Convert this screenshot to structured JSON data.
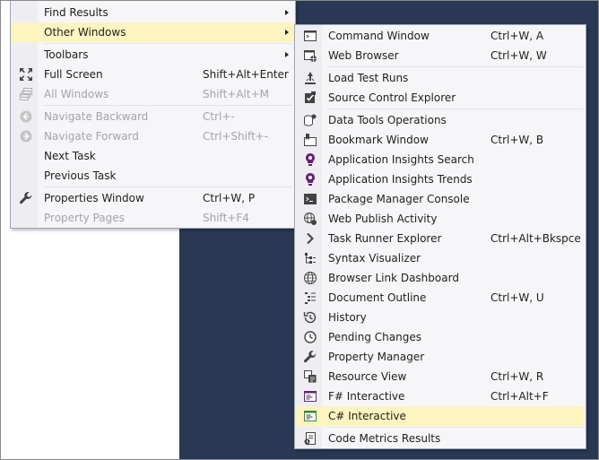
{
  "left_menu": {
    "items": [
      {
        "label": "Find Results",
        "shortcut": "",
        "icon": "none",
        "submenu": true,
        "disabled": false,
        "highlighted": false
      },
      {
        "label": "Other Windows",
        "shortcut": "",
        "icon": "none",
        "submenu": true,
        "disabled": false,
        "highlighted": true
      },
      {
        "label": "Toolbars",
        "shortcut": "",
        "icon": "none",
        "submenu": true,
        "disabled": false,
        "highlighted": false
      },
      {
        "label": "Full Screen",
        "shortcut": "Shift+Alt+Enter",
        "icon": "full-screen-icon",
        "submenu": false,
        "disabled": false,
        "highlighted": false
      },
      {
        "label": "All Windows",
        "shortcut": "Shift+Alt+M",
        "icon": "all-windows-icon",
        "submenu": false,
        "disabled": true,
        "highlighted": false
      },
      {
        "label": "Navigate Backward",
        "shortcut": "Ctrl+-",
        "icon": "navigate-backward-icon",
        "submenu": false,
        "disabled": true,
        "highlighted": false
      },
      {
        "label": "Navigate Forward",
        "shortcut": "Ctrl+Shift+-",
        "icon": "navigate-forward-icon",
        "submenu": false,
        "disabled": true,
        "highlighted": false
      },
      {
        "label": "Next Task",
        "shortcut": "",
        "icon": "none",
        "submenu": false,
        "disabled": false,
        "highlighted": false
      },
      {
        "label": "Previous Task",
        "shortcut": "",
        "icon": "none",
        "submenu": false,
        "disabled": false,
        "highlighted": false
      },
      {
        "label": "Properties Window",
        "shortcut": "Ctrl+W, P",
        "icon": "wrench-icon",
        "submenu": false,
        "disabled": false,
        "highlighted": false
      },
      {
        "label": "Property Pages",
        "shortcut": "Shift+F4",
        "icon": "none",
        "submenu": false,
        "disabled": true,
        "highlighted": false
      }
    ]
  },
  "right_menu": {
    "items": [
      {
        "label": "Command Window",
        "shortcut": "Ctrl+W, A",
        "icon": "command-window-icon",
        "highlighted": false
      },
      {
        "label": "Web Browser",
        "shortcut": "Ctrl+W, W",
        "icon": "web-browser-icon",
        "highlighted": false
      },
      {
        "label": "Load Test Runs",
        "shortcut": "",
        "icon": "load-test-runs-icon",
        "highlighted": false
      },
      {
        "label": "Source Control Explorer",
        "shortcut": "",
        "icon": "source-control-icon",
        "highlighted": false
      },
      {
        "label": "Data Tools Operations",
        "shortcut": "",
        "icon": "data-tools-icon",
        "highlighted": false
      },
      {
        "label": "Bookmark Window",
        "shortcut": "Ctrl+W, B",
        "icon": "bookmark-icon",
        "highlighted": false
      },
      {
        "label": "Application Insights Search",
        "shortcut": "",
        "icon": "lightbulb-icon",
        "highlighted": false
      },
      {
        "label": "Application Insights Trends",
        "shortcut": "",
        "icon": "lightbulb-icon",
        "highlighted": false
      },
      {
        "label": "Package Manager Console",
        "shortcut": "",
        "icon": "console-icon",
        "highlighted": false
      },
      {
        "label": "Web Publish Activity",
        "shortcut": "",
        "icon": "globe-gear-icon",
        "highlighted": false
      },
      {
        "label": "Task Runner Explorer",
        "shortcut": "Ctrl+Alt+Bkspce",
        "icon": "chevron-right-icon",
        "highlighted": false
      },
      {
        "label": "Syntax Visualizer",
        "shortcut": "",
        "icon": "tree-icon",
        "highlighted": false
      },
      {
        "label": "Browser Link Dashboard",
        "shortcut": "",
        "icon": "globe-icon",
        "highlighted": false
      },
      {
        "label": "Document Outline",
        "shortcut": "Ctrl+W, U",
        "icon": "outline-icon",
        "highlighted": false
      },
      {
        "label": "History",
        "shortcut": "",
        "icon": "history-icon",
        "highlighted": false
      },
      {
        "label": "Pending Changes",
        "shortcut": "",
        "icon": "clock-icon",
        "highlighted": false
      },
      {
        "label": "Property Manager",
        "shortcut": "",
        "icon": "wrench-icon",
        "highlighted": false
      },
      {
        "label": "Resource View",
        "shortcut": "Ctrl+W, R",
        "icon": "resource-view-icon",
        "highlighted": false
      },
      {
        "label": "F# Interactive",
        "shortcut": "Ctrl+Alt+F",
        "icon": "fsharp-interactive-icon",
        "highlighted": false
      },
      {
        "label": "C# Interactive",
        "shortcut": "",
        "icon": "csharp-interactive-icon",
        "highlighted": true
      },
      {
        "label": "Code Metrics Results",
        "shortcut": "",
        "icon": "code-metrics-icon",
        "highlighted": false
      }
    ]
  },
  "colors": {
    "background_dark": "#293955",
    "menu_background": "#f6f6f9",
    "highlight": "#fdf4bf",
    "disabled_text": "#a2a4a5",
    "accent_purple": "#68217a"
  }
}
